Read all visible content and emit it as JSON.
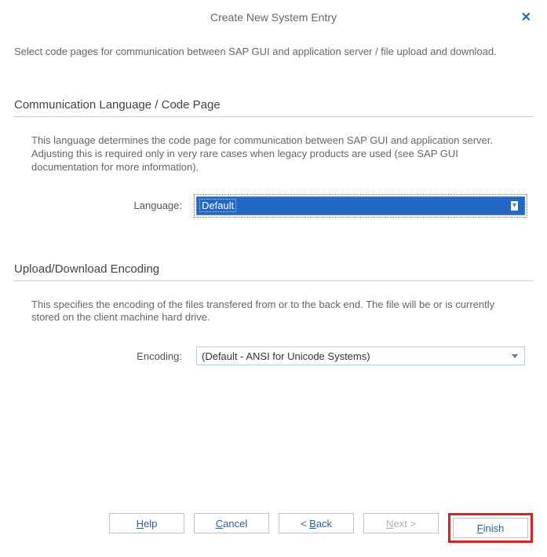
{
  "title": "Create New System Entry",
  "intro": "Select code pages for communication between SAP GUI and application server / file upload and download.",
  "section1": {
    "title": "Communication Language / Code Page",
    "desc": "This language determines the code page for communication between SAP GUI and application server. Adjusting this is required only in very rare cases when legacy products are used (see SAP GUI documentation for more information).",
    "label": "Language:",
    "value": "Default"
  },
  "section2": {
    "title": "Upload/Download Encoding",
    "desc": "This specifies the encoding of the files transfered from or to the back end. The file will be or is currently stored on the client machine hard drive.",
    "label": "Encoding:",
    "value": "(Default - ANSI for Unicode Systems)"
  },
  "buttons": {
    "help_u": "H",
    "help_r": "elp",
    "cancel_u": "C",
    "cancel_r": "ancel",
    "back_pre": "< ",
    "back_u": "B",
    "back_r": "ack",
    "next_u": "N",
    "next_r": "ext >",
    "finish_u": "F",
    "finish_r": "inish"
  }
}
